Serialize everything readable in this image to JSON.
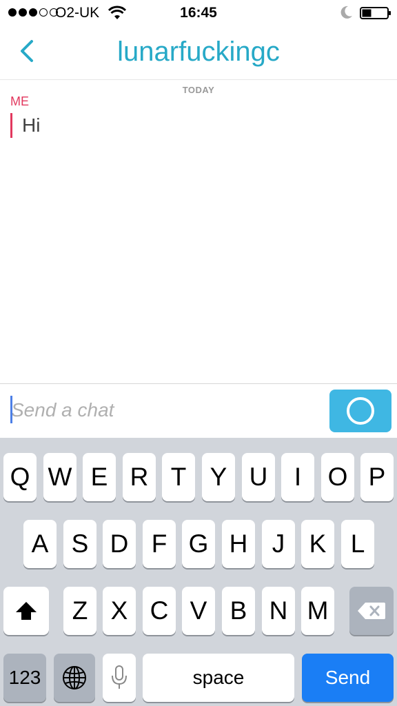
{
  "status_bar": {
    "carrier": "O2-UK",
    "time": "16:45",
    "signal_bars_filled": 3,
    "signal_bars_total": 5
  },
  "nav": {
    "title": "lunarfuckingc",
    "back_icon": "chevron-left-icon"
  },
  "chat": {
    "date_label": "TODAY",
    "messages": [
      {
        "sender": "ME",
        "text": "Hi"
      }
    ]
  },
  "input": {
    "placeholder": "Send a chat",
    "value": "",
    "camera_icon": "camera-circle-icon"
  },
  "keyboard": {
    "row1": [
      "Q",
      "W",
      "E",
      "R",
      "T",
      "Y",
      "U",
      "I",
      "O",
      "P"
    ],
    "row2": [
      "A",
      "S",
      "D",
      "F",
      "G",
      "H",
      "J",
      "K",
      "L"
    ],
    "row3": [
      "Z",
      "X",
      "C",
      "V",
      "B",
      "N",
      "M"
    ],
    "numbers_label": "123",
    "space_label": "space",
    "send_label": "Send",
    "shift_icon": "shift-icon",
    "backspace_icon": "backspace-icon",
    "globe_icon": "globe-icon",
    "mic_icon": "microphone-icon"
  },
  "colors": {
    "accent": "#27a9c7",
    "sender_me": "#e2385e",
    "send_key": "#1a7ef5",
    "camera_button": "#3fb7e3"
  }
}
